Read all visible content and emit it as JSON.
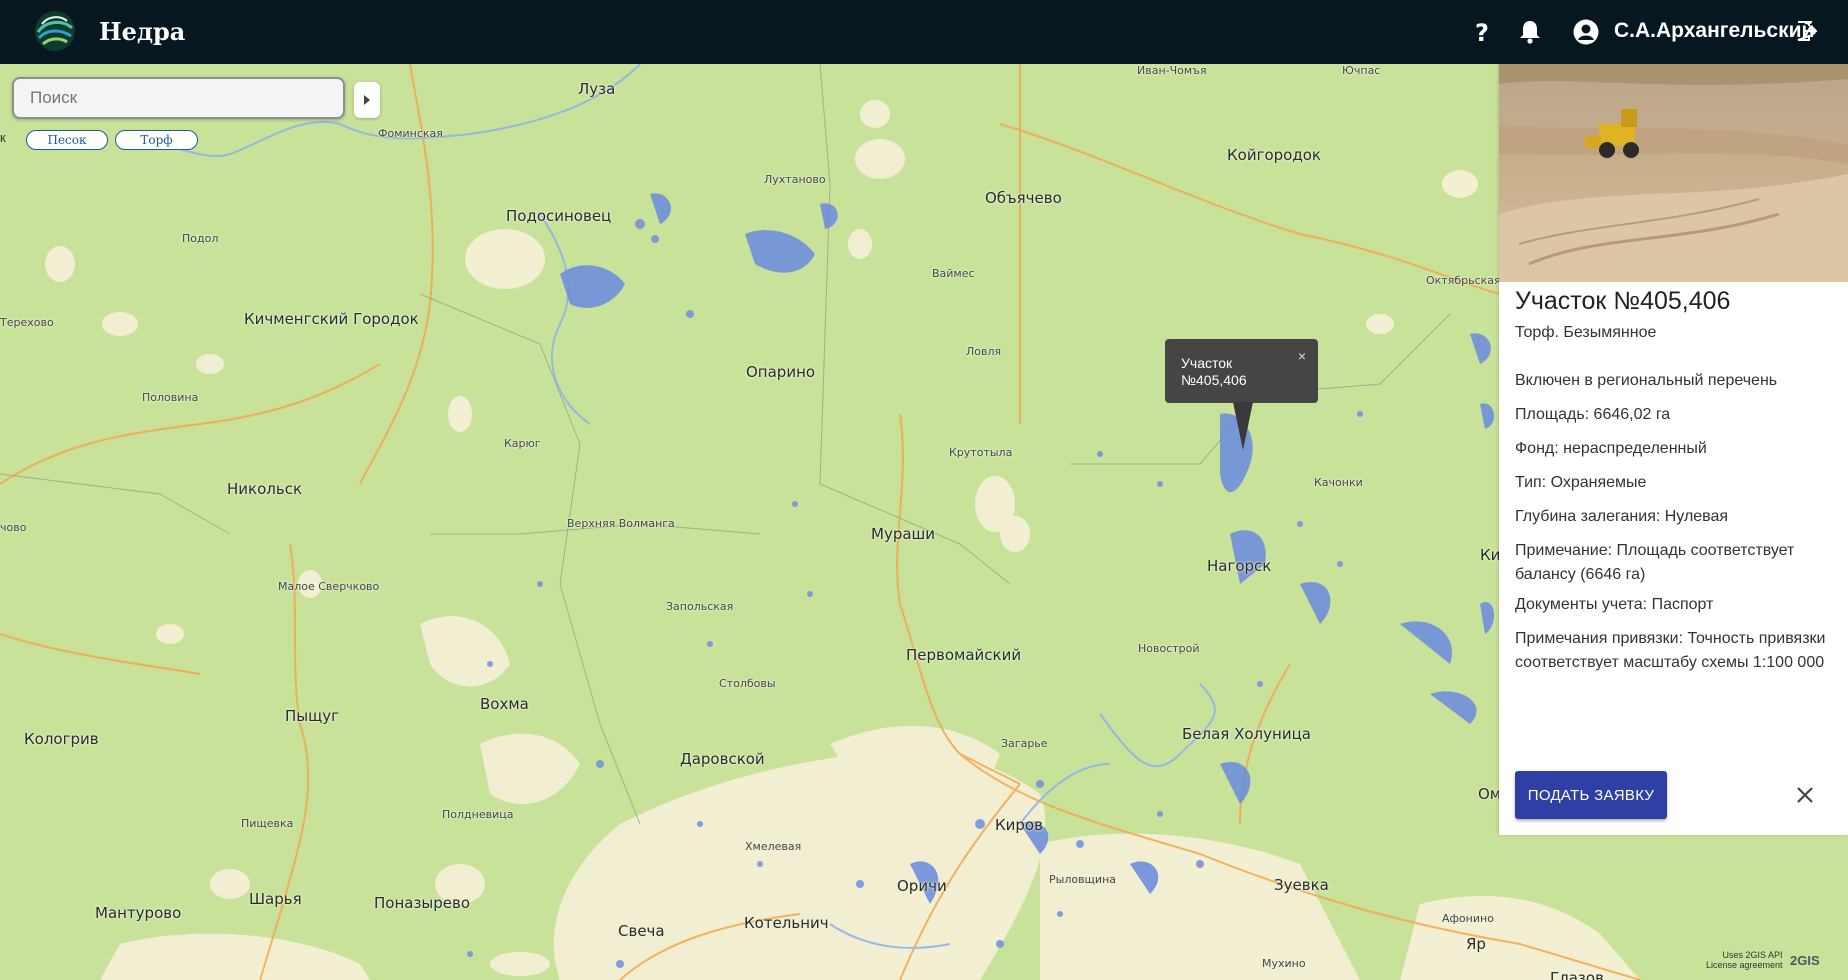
{
  "header": {
    "app_title": "Недра",
    "user_name": "С.А.Архангельский",
    "icons": [
      "logo-icon",
      "help-icon",
      "bell-icon",
      "user-icon",
      "logout-icon"
    ]
  },
  "search": {
    "placeholder": "Поиск"
  },
  "filters": {
    "edge_char": "к",
    "chips": [
      "Песок",
      "Торф"
    ]
  },
  "map_labels": {
    "cities": [
      "Луза",
      "Койгородок",
      "Подосиновец",
      "Объячево",
      "Кичменгский Городок",
      "Опарино",
      "Никольск",
      "Мураши",
      "Нагорск",
      "Первомайский",
      "Вохма",
      "Пыщуг",
      "Кологрив",
      "Даровской",
      "Белая Холуница",
      "Киров",
      "Оричи",
      "Зуевка",
      "Мантурово",
      "Шарья",
      "Поназырево",
      "Свеча",
      "Котельнич",
      "Омутн",
      "Яр",
      "Ки",
      "Глазов"
    ],
    "villages": [
      "Иван-Чомъя",
      "Ючпас",
      "Фоминская",
      "Лухтаново",
      "Подол",
      "Ваймес",
      "Октябрьская",
      "Терехово",
      "Ловля",
      "Половина",
      "Карюг",
      "Крутотыла",
      "Качонки",
      "Верхняя Волманга",
      "чово",
      "Малое Сверчково",
      "Запольская",
      "Новострой",
      "Столбовы",
      "Загарье",
      "Пищевка",
      "Полдневица",
      "Хмелевая",
      "Рыловщина",
      "Афонино",
      "Мухино"
    ]
  },
  "tooltip": {
    "text": "Участок №405,406",
    "close": "×"
  },
  "panel": {
    "title": "Участок №405,406",
    "subtitle": "Торф. Безымянное",
    "lines": [
      "Включен в региональный перечень",
      "Площадь: 6646,02 га",
      "Фонд: нераспределенный",
      "Тип: Охраняемые",
      "Глубина залегания: Нулевая",
      "Примечание: Площадь соответствует балансу (6646 га)",
      "Документы учета: Паспорт",
      "Примечания привязки: Точность привязки соответствует масштабу схемы 1:100 000"
    ],
    "apply_label": "ПОДАТЬ ЗАЯВКУ"
  },
  "attribution": {
    "line1": "Uses 2GIS API",
    "line2": "License agreement",
    "logo": "2GIS"
  },
  "colors": {
    "header_bg": "#07171f",
    "map_bg": "#c8e29a",
    "water": "#6f8fdc",
    "urban": "#f5efd5",
    "roads": "#f2a84c",
    "button": "#2f3fa4",
    "tooltip_bg": "#454545"
  }
}
